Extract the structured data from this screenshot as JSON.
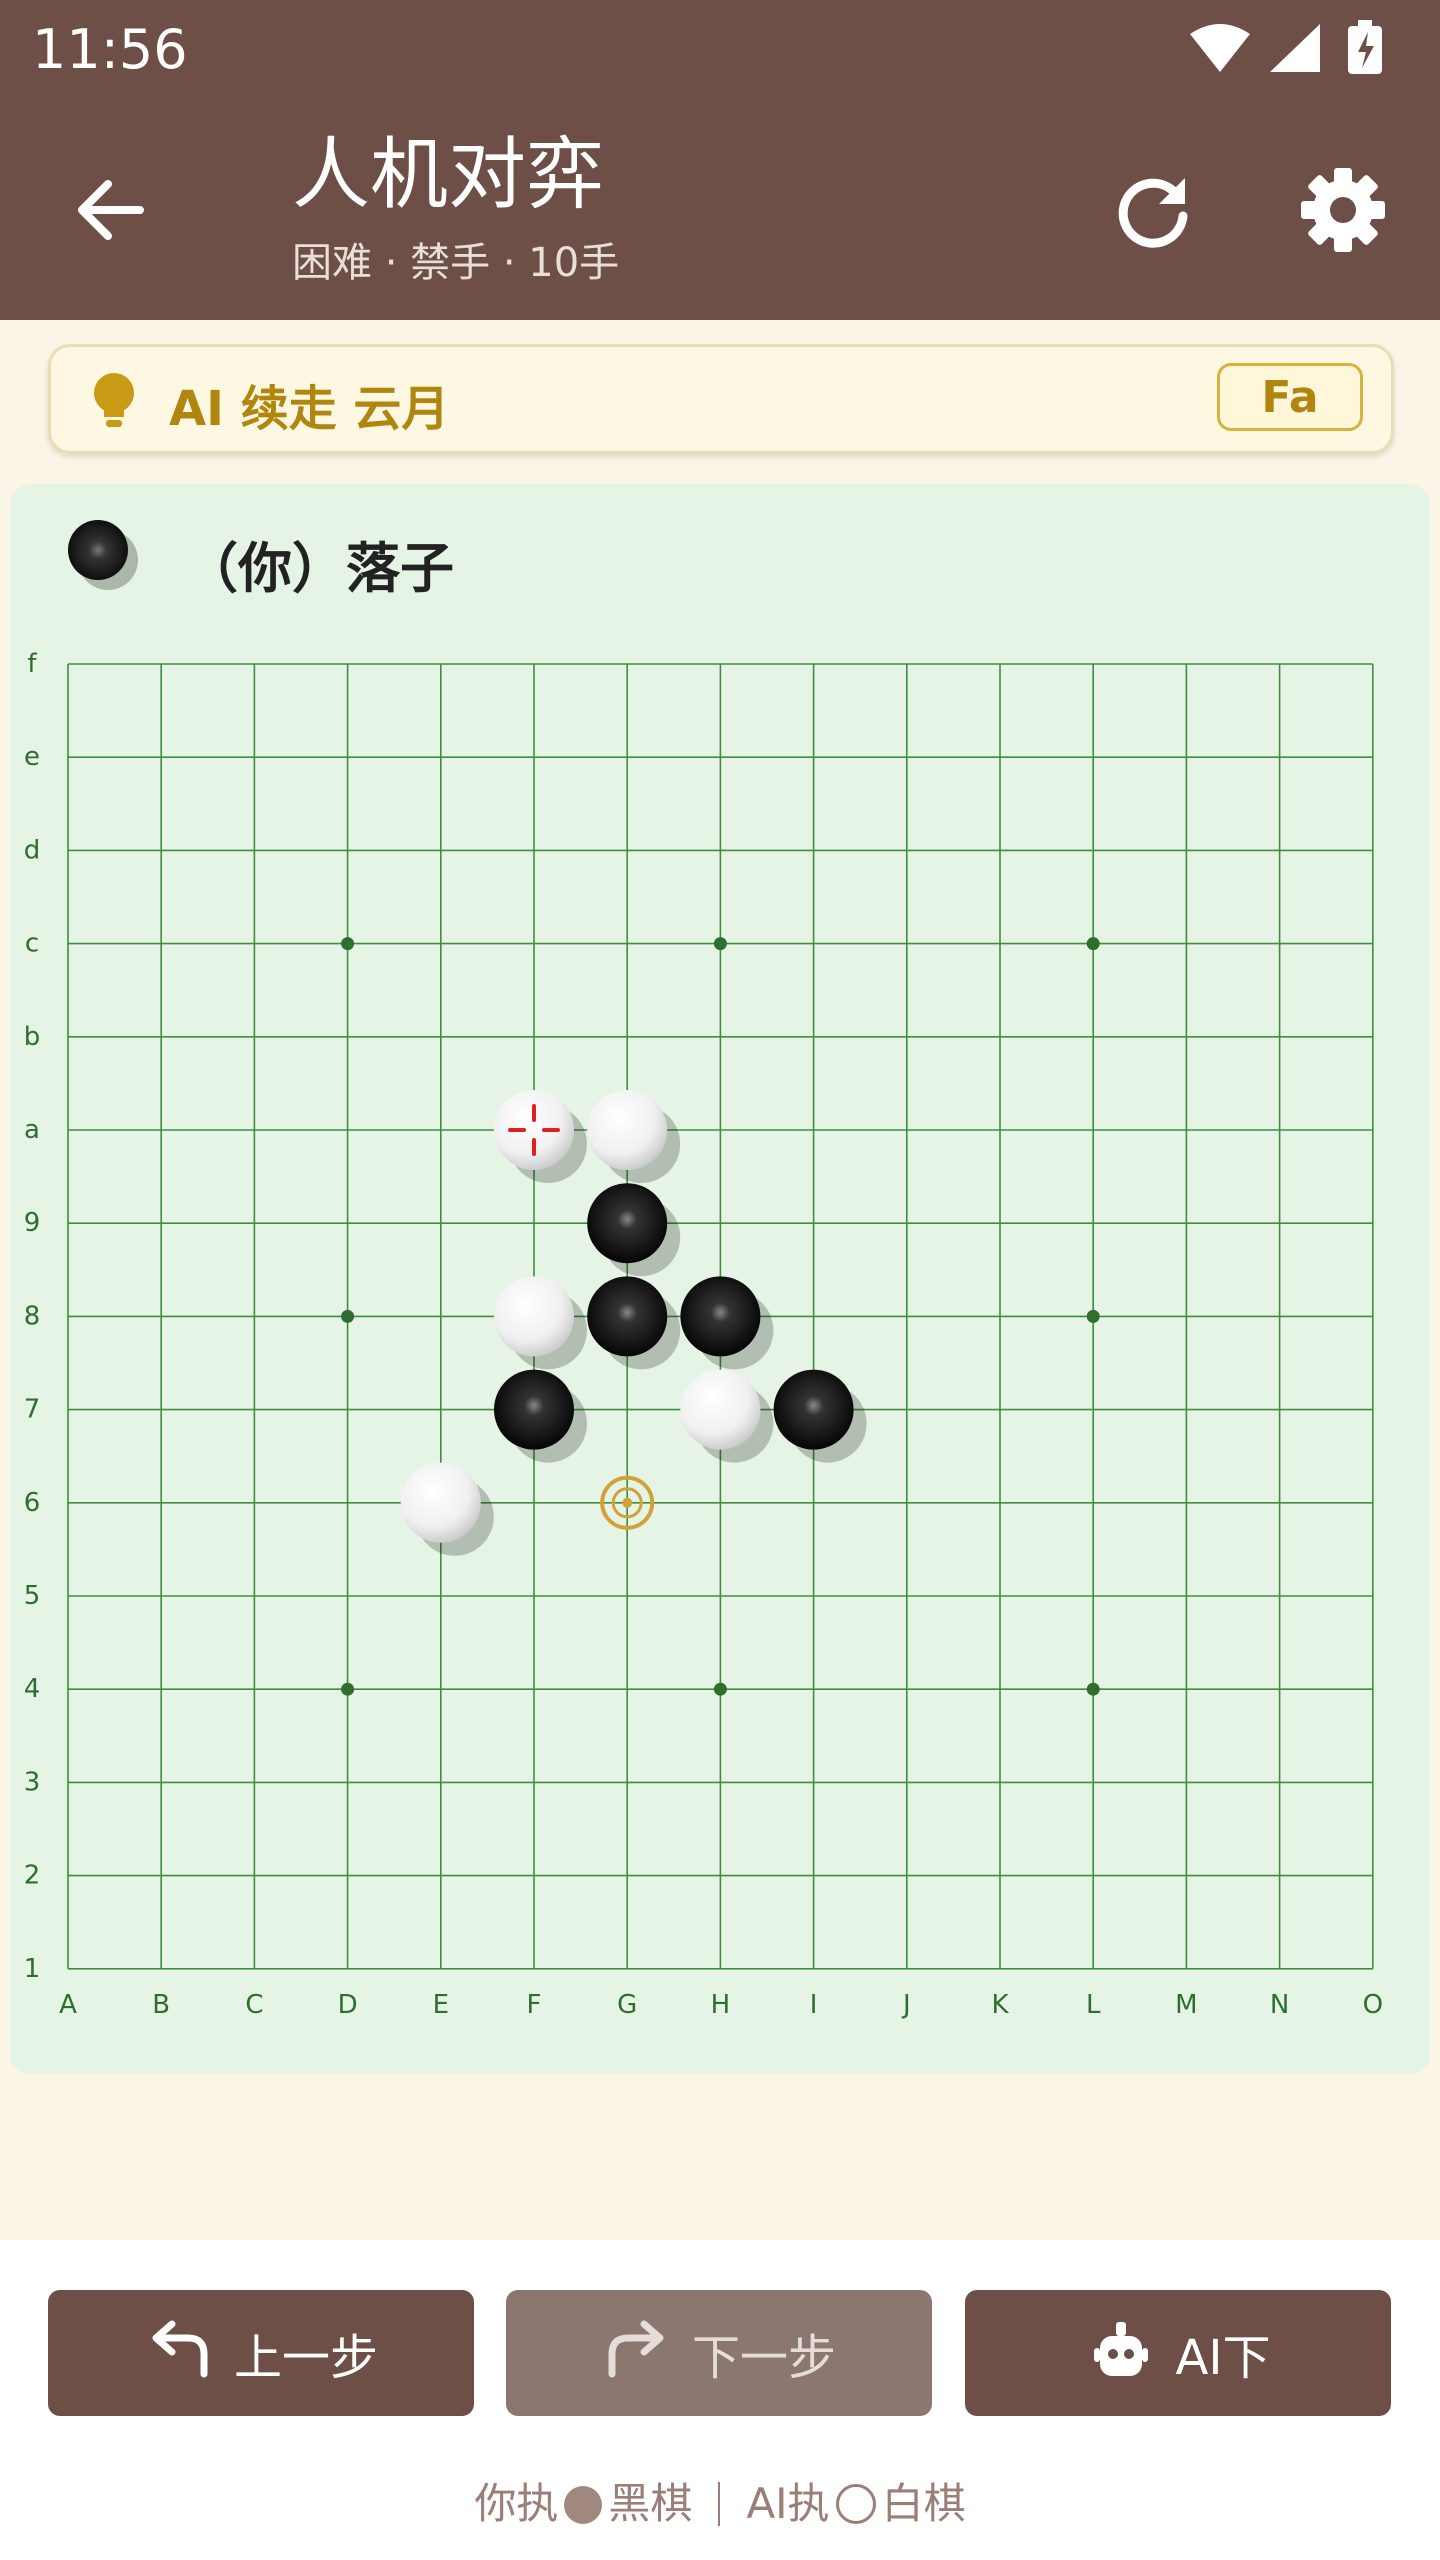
{
  "status_bar": {
    "time": "11:56",
    "icons": [
      "wifi-icon",
      "signal-icon",
      "battery-charging-icon"
    ]
  },
  "app_bar": {
    "title": "人机对弈",
    "subtitle": "困难 · 禁手 · 10手",
    "icons": [
      "arrow-left-icon",
      "refresh-icon",
      "gear-icon"
    ]
  },
  "hint": {
    "text": "AI 续走 云月",
    "tag": "Fa",
    "icon": "lightbulb-icon"
  },
  "turn": {
    "label": "（你）落子"
  },
  "board": {
    "columns": [
      "A",
      "B",
      "C",
      "D",
      "E",
      "F",
      "G",
      "H",
      "I",
      "J",
      "K",
      "L",
      "M",
      "N",
      "O"
    ],
    "rows_top_to_bottom": [
      "f",
      "e",
      "d",
      "c",
      "b",
      "a",
      "9",
      "8",
      "7",
      "6",
      "5",
      "4",
      "3",
      "2",
      "1"
    ],
    "star_points": [
      "Dc",
      "Hc",
      "Lc",
      "D8",
      "L8",
      "D4",
      "H4",
      "L4"
    ],
    "stones": [
      {
        "color": "white",
        "pos": "Fa",
        "last": true
      },
      {
        "color": "white",
        "pos": "Ga"
      },
      {
        "color": "black",
        "pos": "G9"
      },
      {
        "color": "white",
        "pos": "F8"
      },
      {
        "color": "black",
        "pos": "G8"
      },
      {
        "color": "black",
        "pos": "H8"
      },
      {
        "color": "black",
        "pos": "F7"
      },
      {
        "color": "white",
        "pos": "H7"
      },
      {
        "color": "black",
        "pos": "I7"
      },
      {
        "color": "white",
        "pos": "E6"
      }
    ],
    "target": "G6",
    "colors": {
      "grid": "#3E8E3E",
      "background": "#E6F4E6",
      "label": "#2E6E2E",
      "marker": "#E02020",
      "target": "#D2A23A"
    }
  },
  "controls": {
    "prev_label": "上一步",
    "next_label": "下一步",
    "ai_label": "AI下"
  },
  "footer": {
    "you": "你执",
    "you_color": "黑棋",
    "ai": "AI执",
    "ai_color": "白棋"
  },
  "colors": {
    "primary": "#6D4F47",
    "accent": "#B0860F",
    "page_bg": "#FBF5E7"
  }
}
